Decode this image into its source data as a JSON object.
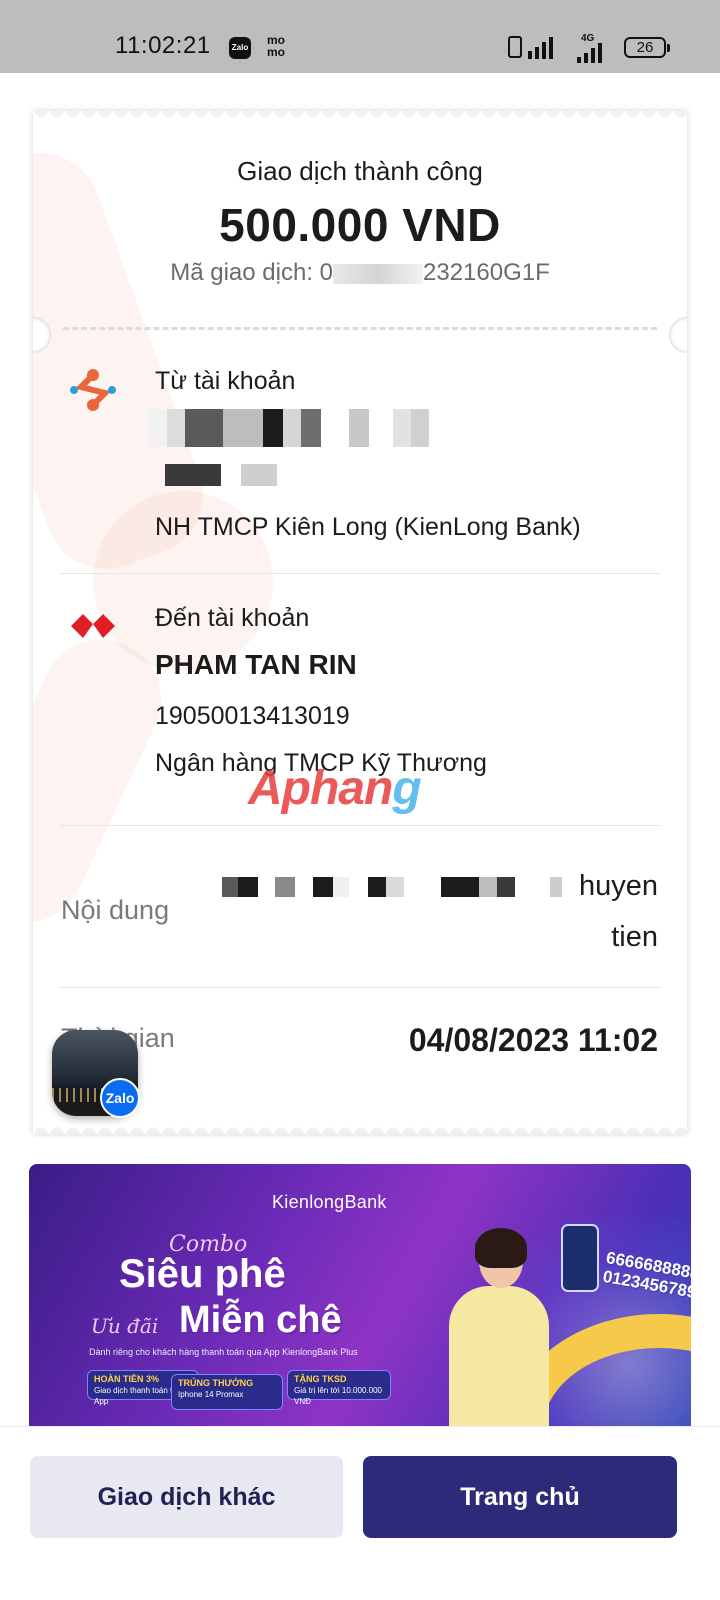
{
  "status_bar": {
    "time": "11:02:21",
    "zalo_label": "Zalo",
    "momo_label": "mo mo",
    "network": "4G",
    "battery": "26"
  },
  "receipt": {
    "status": "Giao dịch thành công",
    "amount": "500.000 VND",
    "txn_prefix": "Mã giao dịch: 0",
    "txn_suffix": "232160G1F",
    "from": {
      "label": "Từ tài khoản",
      "bank": "NH TMCP Kiên Long (KienLong Bank)"
    },
    "to": {
      "label": "Đến tài khoản",
      "name": "PHAM TAN RIN",
      "account": "19050013413019",
      "bank": "Ngân hàng TMCP Kỹ Thương"
    },
    "content": {
      "label": "Nội dung",
      "value_line1": "huyen",
      "value_line2": "tien"
    },
    "time": {
      "label": "Thời gian",
      "value": "04/08/2023 11:02"
    }
  },
  "watermark": {
    "part1": "Aphan",
    "part2": "g"
  },
  "zalo_bubble": {
    "badge": "Zalo"
  },
  "banner": {
    "brand": "KienlongBank",
    "combo": "Combo",
    "line1": "Siêu phê",
    "uudai": "Ưu đãi",
    "line2": "Miễn chê",
    "subtitle": "Dành riêng cho khách hàng thanh toán qua App KienlongBank Plus",
    "chip1_title": "HOÀN TIỀN 3%",
    "chip1_sub": "Giao dịch thanh toán trên App",
    "chip2_title": "TRÚNG THƯỞNG",
    "chip2_sub": "Iphone 14 Promax",
    "chip3_title": "TẶNG TKSD",
    "chip3_sub": "Giá trị lên tới 10.000.000 VNĐ",
    "number1": "6666688888",
    "number2": "0123456789"
  },
  "actions": {
    "other": "Giao dịch khác",
    "home": "Trang chủ"
  },
  "colors": {
    "primary": "#2e2a7a",
    "secondary_bg": "#e7e8f0",
    "kienlong_orange": "#e9663c",
    "techcombank_red": "#e01e26"
  }
}
